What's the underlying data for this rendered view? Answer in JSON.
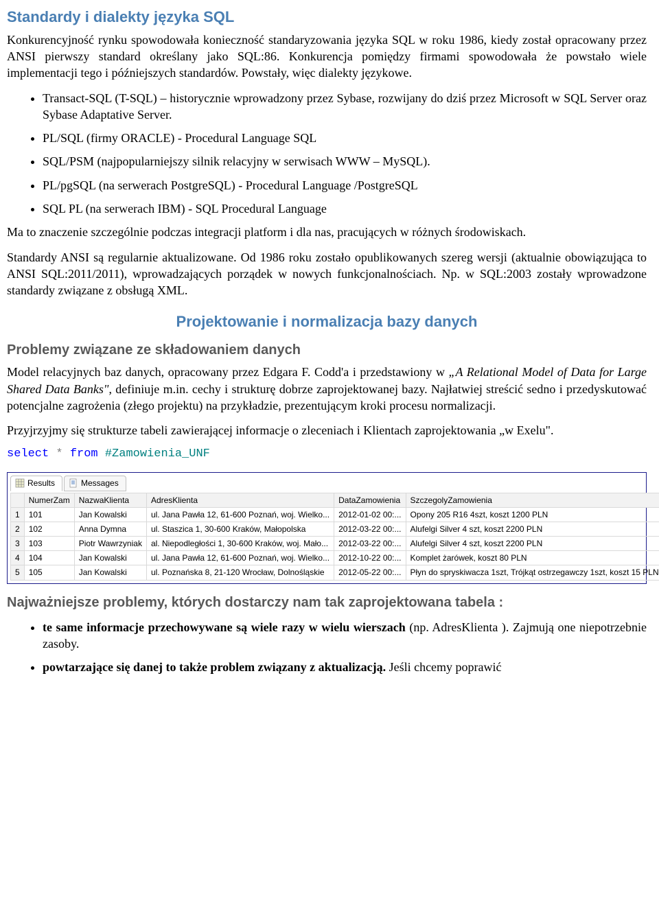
{
  "title": "Standardy i dialekty języka SQL",
  "p1": "Konkurencyjność rynku spowodowała konieczność standaryzowania języka SQL w roku 1986, kiedy został opracowany przez ANSI pierwszy standard określany jako SQL:86.  Konkurencja pomiędzy firmami spowodowała że powstało wiele implementacji tego i późniejszych standardów. Powstały, więc dialekty językowe.",
  "bullets1": [
    "Transact-SQL (T-SQL) – historycznie wprowadzony przez Sybase, rozwijany do dziś przez Microsoft w SQL Server oraz Sybase Adaptative Server.",
    "PL/SQL (firmy ORACLE)  - Procedural Language SQL",
    "SQL/PSM (najpopularniejszy silnik relacyjny w serwisach WWW – MySQL).",
    "PL/pgSQL (na serwerach PostgreSQL)  - Procedural Language /PostgreSQL",
    "SQL PL  (na serwerach IBM) -  SQL  Procedural Language"
  ],
  "p2": "Ma to znaczenie szczególnie podczas integracji platform i dla nas, pracujących w różnych środowiskach.",
  "p3": "Standardy ANSI są regularnie aktualizowane. Od 1986 roku zostało opublikowanych szereg wersji (aktualnie obowiązująca to ANSI SQL:2011/2011), wprowadzających porządek w nowych funkcjonalnościach. Np. w SQL:2003 zostały wprowadzone standardy związane z obsługą XML.",
  "section2": "Projektowanie i normalizacja bazy danych",
  "sub1": "Problemy związane ze składowaniem danych",
  "p4a": "Model relacyjnych baz danych, opracowany przez Edgara F. Codd'a i przedstawiony w ",
  "p4b_italic": "„A Relational Model of Data for Large Shared Data Banks\"",
  "p4c": ", definiuje m.in. cechy i strukturę dobrze zaprojektowanej bazy. Najłatwiej streścić sedno i przedyskutować potencjalne zagrożenia (złego projektu) na przykładzie, prezentującym kroki procesu normalizacji.",
  "p5": "Przyjrzyjmy się strukturze tabeli zawierającej informacje o zleceniach i Klientach zaprojektowania „w Exelu\".",
  "code": {
    "kw1": "select",
    "star": "*",
    "kw2": "from",
    "ident": "#Zamowienia_UNF"
  },
  "tabs": {
    "results": "Results",
    "messages": "Messages"
  },
  "chart_data": {
    "type": "table",
    "columns": [
      "NumerZam",
      "NazwaKlienta",
      "AdresKlienta",
      "DataZamowienia",
      "SzczegolyZamowienia"
    ],
    "rows": [
      [
        "101",
        "Jan Kowalski",
        "ul. Jana Pawła 12, 61-600 Poznań, woj. Wielko...",
        "2012-01-02 00:...",
        "Opony 205 R16 4szt, koszt 1200 PLN"
      ],
      [
        "102",
        "Anna Dymna",
        "ul. Staszica 1, 30-600 Kraków, Małopolska",
        "2012-03-22 00:...",
        "Alufelgi Silver 4 szt, koszt 2200 PLN"
      ],
      [
        "103",
        "Piotr Wawrzyniak",
        "al. Niepodległości 1, 30-600 Kraków, woj. Mało...",
        "2012-03-22 00:...",
        "Alufelgi Silver 4 szt, koszt 2200 PLN"
      ],
      [
        "104",
        "Jan Kowalski",
        "ul. Jana Pawła 12, 61-600 Poznań, woj. Wielko...",
        "2012-10-22 00:...",
        "Komplet żarówek, koszt 80 PLN"
      ],
      [
        "105",
        "Jan Kowalski",
        "ul. Poznańska 8, 21-120 Wrocław, Dolnośląskie",
        "2012-05-22 00:...",
        "Płyn do spryskiwacza 1szt, Trójkąt ostrzegawczy 1szt, koszt 15 PLN"
      ]
    ]
  },
  "sub2": "Najważniejsze problemy, których dostarczy nam tak zaprojektowana tabela :",
  "bullets2": [
    {
      "bold": "te same informacje przechowywane są wiele razy w wielu wierszach",
      "rest": " (np. AdresKlienta ). Zajmują one niepotrzebnie zasoby."
    },
    {
      "bold": "powtarzające się danej to także problem związany z aktualizacją.",
      "rest": " Jeśli chcemy poprawić"
    }
  ]
}
